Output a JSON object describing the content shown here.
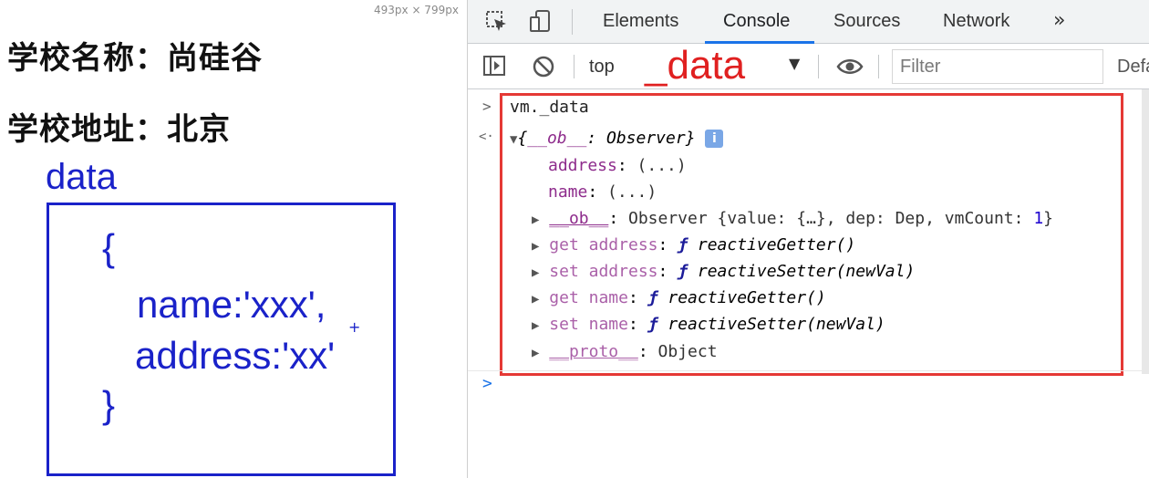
{
  "page": {
    "dimensions_text": "493px × 799px",
    "school_name": "学校名称：尚硅谷",
    "school_address": "学校地址：北京"
  },
  "annotation": {
    "label": "data",
    "code": {
      "open_brace": "{",
      "line1": "name:'xxx',",
      "line2": "address:'xx'",
      "close_brace": "}",
      "plus_mark": "+"
    },
    "devtools_overlay": "_data"
  },
  "devtools": {
    "tabs": [
      "Elements",
      "Console",
      "Sources",
      "Network"
    ],
    "more_tabs": "»",
    "active_tab": "Console",
    "context_selector": "top",
    "filter_placeholder": "Filter",
    "levels_label": "Defa"
  },
  "console": {
    "input": "vm._data",
    "result_summary_open": "{",
    "result_summary_key": "__ob__",
    "result_summary_sep": ": ",
    "result_summary_value": "Observer",
    "result_summary_close": "}",
    "info_badge": "i",
    "properties": [
      {
        "key": "address",
        "value": "(...)"
      },
      {
        "key": "name",
        "value": "(...)"
      }
    ],
    "ob_line": {
      "key": "__ob__",
      "value_prefix": "Observer {value: {…}, dep: Dep, vmCount: ",
      "vm_count": "1",
      "value_suffix": "}"
    },
    "accessors": [
      {
        "prefix": "get address",
        "fname": "reactiveGetter()"
      },
      {
        "prefix": "set address",
        "fname": "reactiveSetter(newVal)"
      },
      {
        "prefix": "get name",
        "fname": "reactiveGetter()"
      },
      {
        "prefix": "set name",
        "fname": "reactiveSetter(newVal)"
      }
    ],
    "proto": {
      "key": "__proto__",
      "value": "Object"
    },
    "colon": ": ",
    "func_glyph": "ƒ",
    "expand_arrow": "▶",
    "collapse_arrow": "▼",
    "input_prompt": ">",
    "result_prompt": "<·",
    "empty_prompt": ">"
  },
  "colors": {
    "annotation_blue": "#1a22c9",
    "highlight_red": "#e53935",
    "tab_active_underline": "#1a73e8",
    "key_purple": "#8e2c8c"
  }
}
